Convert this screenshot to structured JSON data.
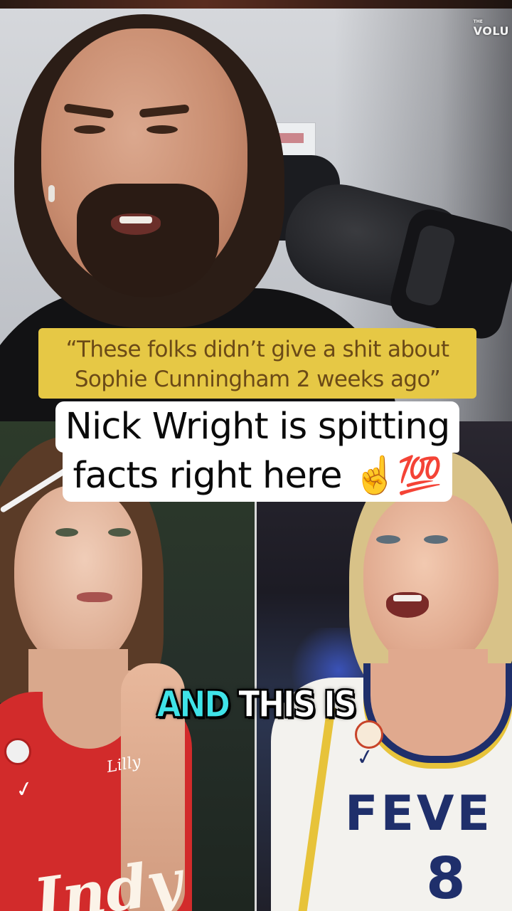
{
  "watermark": {
    "small": "THE",
    "text": "VOLU"
  },
  "quote": {
    "line1": "“These folks didn’t give a shit about",
    "line2": "Sophie Cunningham 2 weeks ago”"
  },
  "headline": {
    "line1": "Nick Wright is spitting",
    "line2": "facts right here ☝️💯"
  },
  "subtitle": {
    "word_active": "AND",
    "words_rest": "THIS IS"
  },
  "left_player": {
    "jersey_sponsor": "Lilly",
    "jersey_text": "Indy"
  },
  "right_player": {
    "jersey_text": "FEVE",
    "jersey_number": "8"
  },
  "colors": {
    "quote_bg": "#e6c845",
    "quote_text": "#6b4a17",
    "subtitle_active": "#3fe3e8",
    "left_jersey": "#d22b2b",
    "right_jersey_accent": "#1f2f6b"
  }
}
